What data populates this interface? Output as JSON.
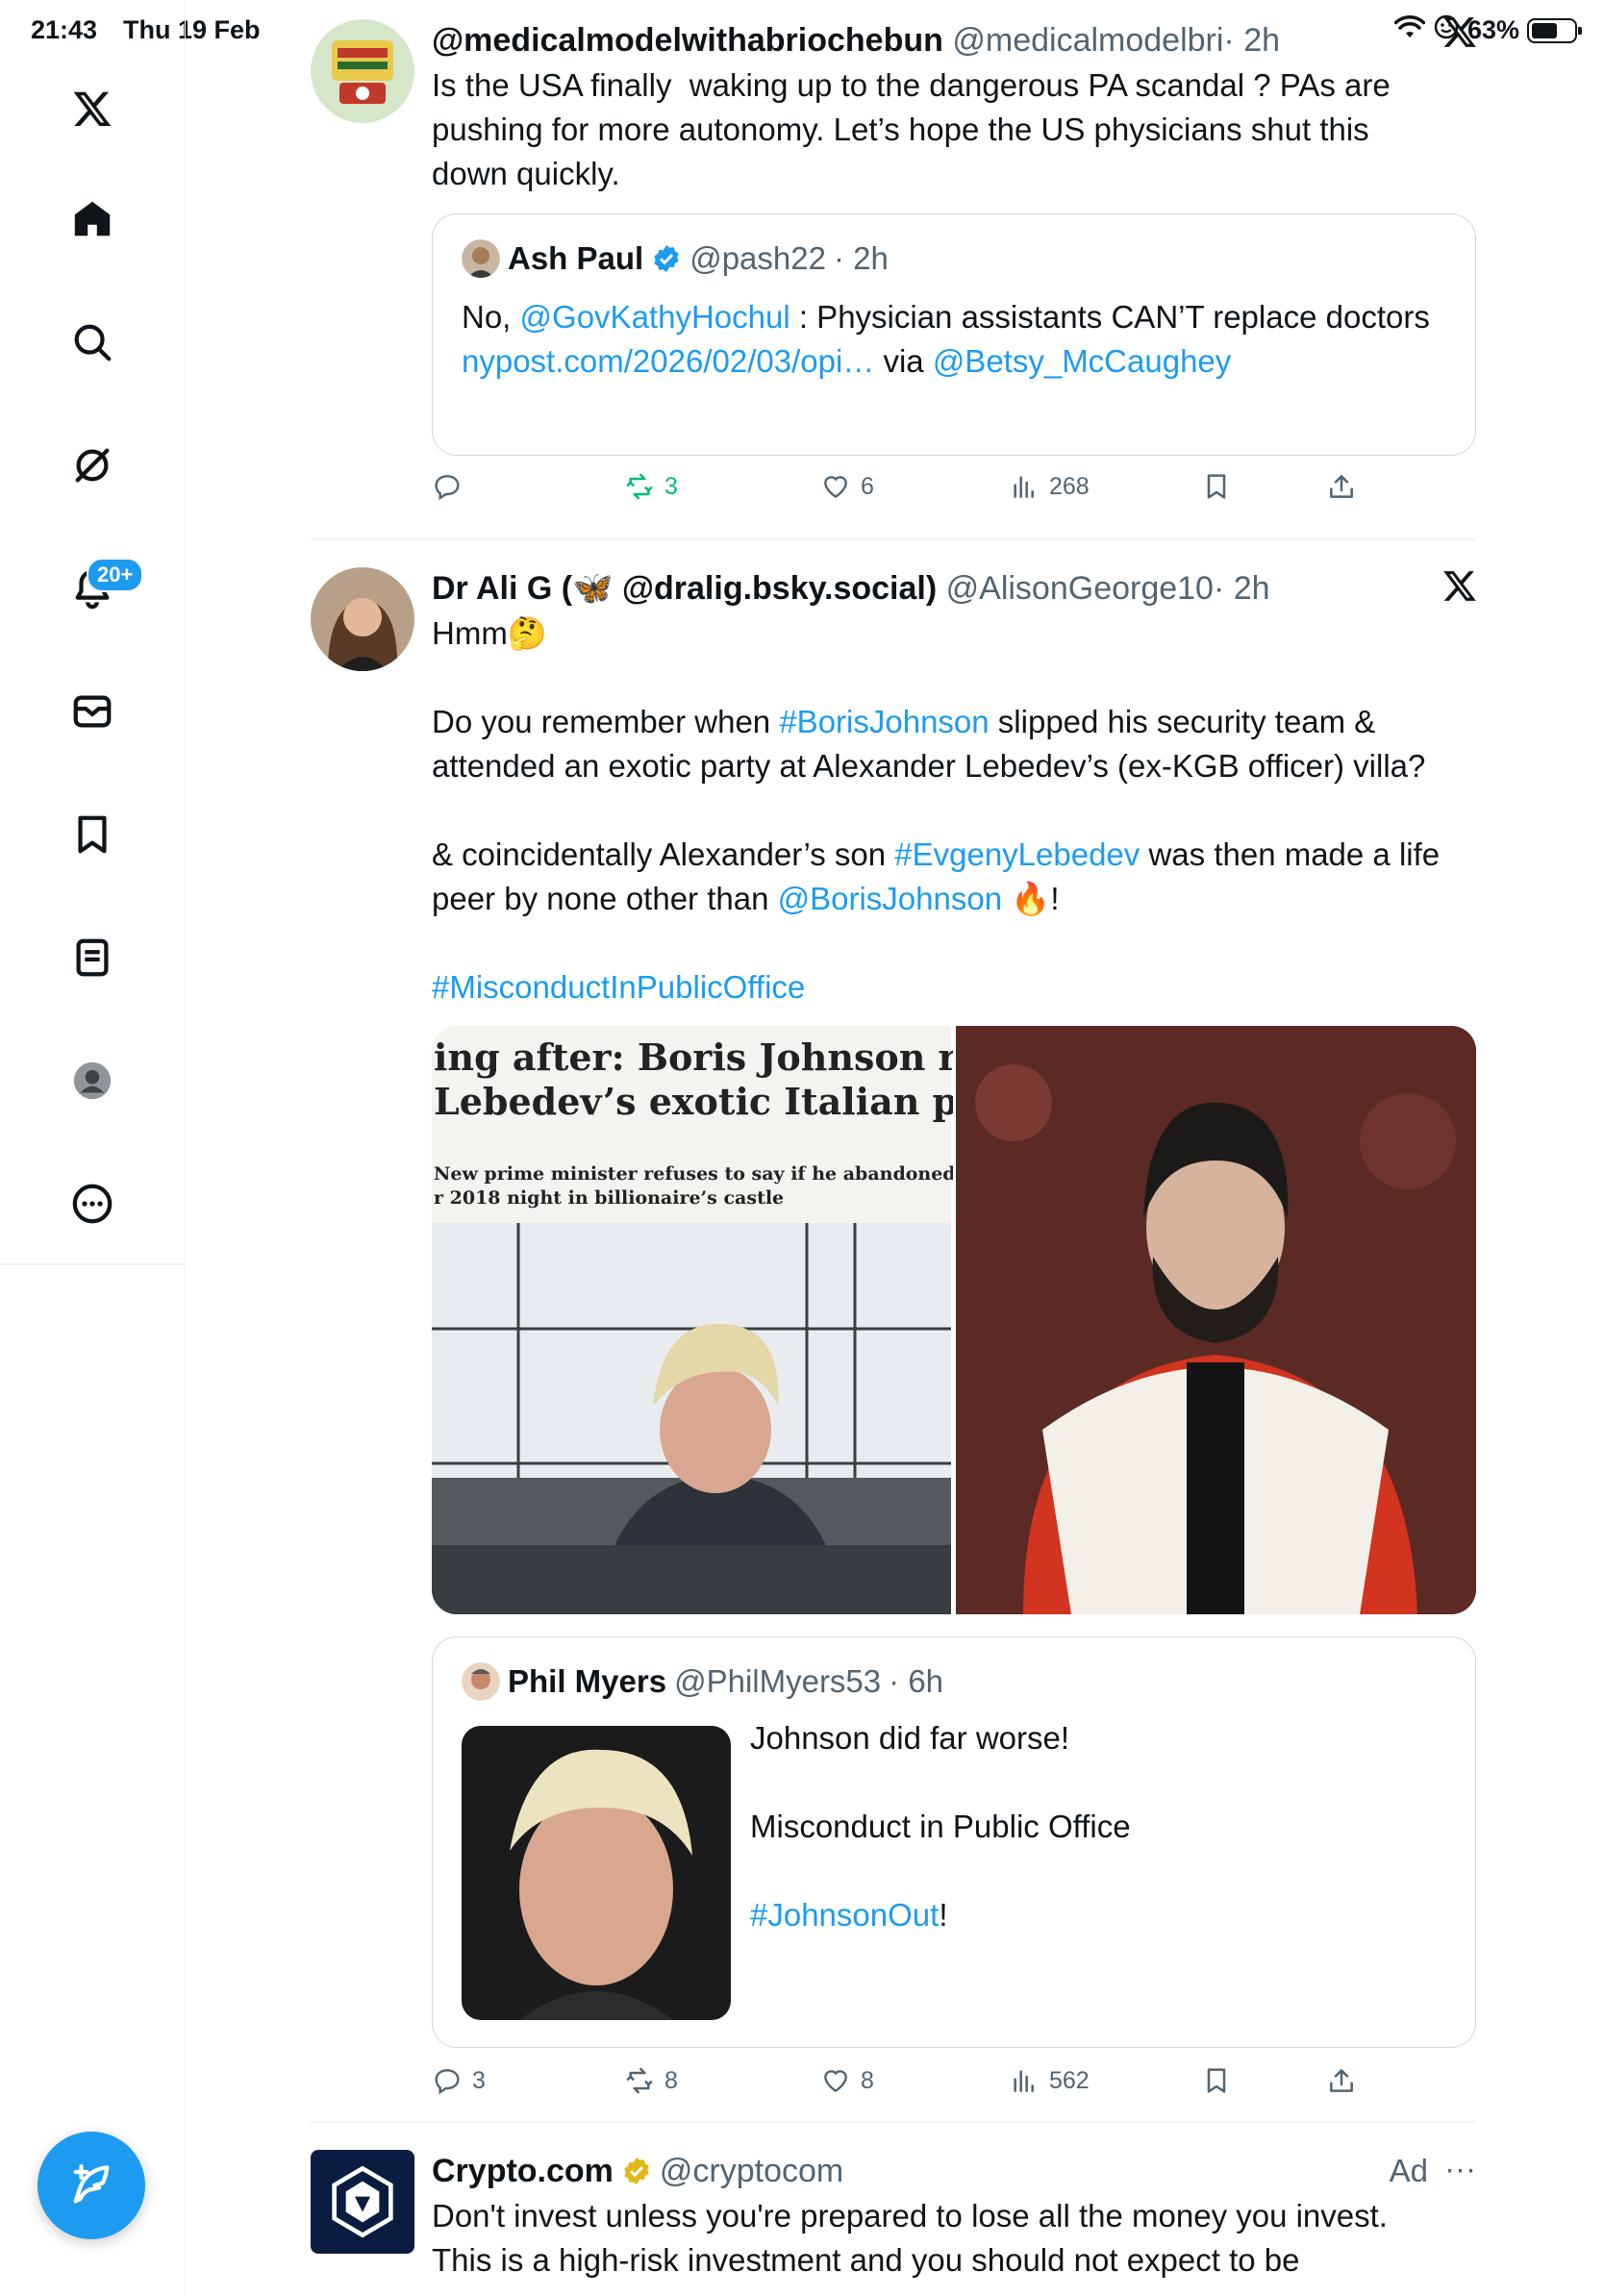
{
  "status_bar": {
    "time": "21:43",
    "date": "Thu 19 Feb",
    "battery": "63%"
  },
  "sidebar": {
    "items": [
      {
        "name": "x-logo-icon"
      },
      {
        "name": "home-icon"
      },
      {
        "name": "search-icon"
      },
      {
        "name": "grok-icon"
      },
      {
        "name": "notifications-icon"
      },
      {
        "name": "messages-icon"
      },
      {
        "name": "bookmarks-icon"
      },
      {
        "name": "lists-icon"
      },
      {
        "name": "profile-icon"
      },
      {
        "name": "more-icon"
      }
    ],
    "notifications_badge": "20+",
    "compose_icon": "compose-feather-icon"
  },
  "tweets": [
    {
      "name": "@medicalmodelwithabriochebun",
      "handle": "@medicalmodelbri",
      "time": "· 2h",
      "text": "Is the USA finally  waking up to the dangerous PA scandal ? PAs are pushing for more autonomy. Let’s hope the US physicians shut this down quickly.",
      "quote": {
        "name": "Ash Paul",
        "handle": "@pash22",
        "time": "· 2h",
        "text_prefix": "No, ",
        "mention1": "@GovKathyHochul",
        "text_mid": " : Physician assistants CAN’T replace doctors",
        "link": "nypost.com/2026/02/03/opi…",
        "via": " via ",
        "mention2": "@Betsy_McCaughey"
      },
      "actions": {
        "replies": "",
        "retweets": "3",
        "likes": "6",
        "views": "268"
      }
    },
    {
      "name": "Dr Ali G (🦋 @dralig.bsky.social)",
      "handle": "@AlisonGeorge10",
      "time": "· 2h",
      "line1": "Hmm🤔",
      "line2_pre": "Do you remember when ",
      "line2_tag": "#BorisJohnson",
      "line2_post": " slipped his security team & attended an exotic party at Alexander Lebedev’s (ex-KGB officer) villa?",
      "line3_pre": "& coincidentally Alexander’s son ",
      "line3_tag": "#EvgenyLebedev",
      "line3_mid": " was then made a life peer by none other than ",
      "line3_mention": "@BorisJohnson",
      "line3_post": " 🔥!",
      "line4_tag": "#MisconductInPublicOffice",
      "media_headline_1": "ing after: Boris Johnson recove",
      "media_headline_2": "Lebedev’s exotic Italian party",
      "media_sub_1": "New prime minister refuses to say if he abandoned",
      "media_sub_2": "r 2018 night in billionaire’s castle",
      "quote": {
        "name": "Phil Myers",
        "handle": "@PhilMyers53",
        "time": "· 6h",
        "line1": "Johnson did far worse!",
        "line2": "Misconduct in Public Office",
        "tag": "#JohnsonOut",
        "tag_suffix": "!"
      },
      "actions": {
        "replies": "3",
        "retweets": "8",
        "likes": "8",
        "views": "562"
      }
    },
    {
      "name": "Crypto.com",
      "handle": "@cryptocom",
      "ad_label": "Ad",
      "text": "Don't invest unless you're prepared to lose all the money you invest. This is a high-risk investment and you should not expect to be"
    }
  ],
  "colors": {
    "accent": "#1d9bf0",
    "text": "#0f1419",
    "muted": "#536471",
    "retweet": "#00ba7c",
    "border": "#cfd9de"
  }
}
